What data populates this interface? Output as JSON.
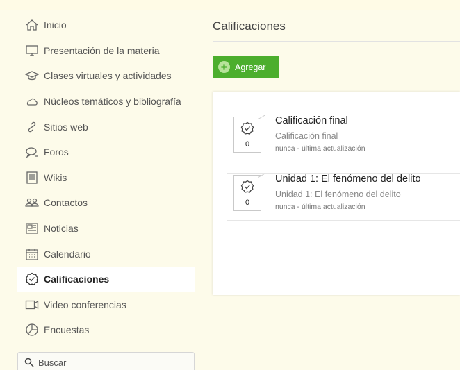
{
  "sidebar": {
    "items": [
      {
        "label": "Inicio",
        "icon": "home-icon"
      },
      {
        "label": "Presentación de la materia",
        "icon": "monitor-icon"
      },
      {
        "label": "Clases virtuales y actividades",
        "icon": "graduation-cap-icon"
      },
      {
        "label": "Núcleos temáticos y bibliografía",
        "icon": "cloud-icon"
      },
      {
        "label": "Sitios web",
        "icon": "link-icon"
      },
      {
        "label": "Foros",
        "icon": "chat-bubbles-icon"
      },
      {
        "label": "Wikis",
        "icon": "document-icon"
      },
      {
        "label": "Contactos",
        "icon": "contacts-icon"
      },
      {
        "label": "Noticias",
        "icon": "newspaper-icon"
      },
      {
        "label": "Calendario",
        "icon": "calendar-icon"
      },
      {
        "label": "Calificaciones",
        "icon": "grade-check-icon",
        "active": true
      },
      {
        "label": "Video conferencias",
        "icon": "video-camera-icon"
      },
      {
        "label": "Encuestas",
        "icon": "pie-chart-icon"
      }
    ]
  },
  "search": {
    "placeholder": "Buscar",
    "icon": "search-icon"
  },
  "main": {
    "title": "Calificaciones",
    "add_label": "Agregar",
    "grades": [
      {
        "title": "Calificación final",
        "subtitle": "Calificación final",
        "meta": "nunca - última actualización",
        "value": "0"
      },
      {
        "title": "Unidad 1: El fenómeno del delito",
        "subtitle": "Unidad 1: El fenómeno del delito",
        "meta": "nunca - última actualización",
        "value": "0"
      }
    ]
  },
  "colors": {
    "accent_green": "#4cae2d",
    "active_bg": "#ffffff",
    "page_bg": "#fdfbea"
  }
}
